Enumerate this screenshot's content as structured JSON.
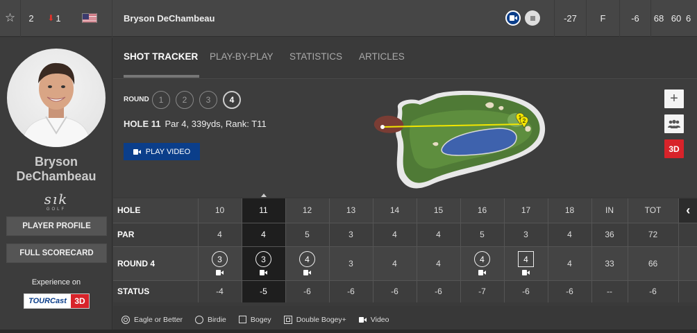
{
  "top_row": {
    "position": "2",
    "movement": "1",
    "player_name": "Bryson DeChambeau",
    "total": "-27",
    "thru": "F",
    "today": "-6",
    "rounds": [
      "68",
      "60",
      "6"
    ]
  },
  "left": {
    "name_line1": "Bryson",
    "name_line2": "DeChambeau",
    "sponsor": "sık",
    "sponsor_sub": "GOLF",
    "profile_btn": "PLAYER PROFILE",
    "scorecard_btn": "FULL SCORECARD",
    "experience": "Experience on",
    "tourcast": "TOURCast",
    "tourcast_3d": "3D"
  },
  "tabs": [
    "SHOT TRACKER",
    "PLAY-BY-PLAY",
    "STATISTICS",
    "ARTICLES"
  ],
  "shot_tracker": {
    "round_label": "ROUND",
    "rounds": [
      "1",
      "2",
      "3",
      "4"
    ],
    "hole": "HOLE 11",
    "hole_detail": "Par 4, 339yds, Rank: T11",
    "play_video": "PLAY VIDEO",
    "zoom_plus": "+",
    "mode_3d": "3D",
    "shot_markers": [
      "1",
      "2"
    ]
  },
  "scorecard": {
    "labels": {
      "hole": "HOLE",
      "par": "PAR",
      "round": "ROUND 4",
      "status": "STATUS"
    },
    "holes": [
      "10",
      "11",
      "12",
      "13",
      "14",
      "15",
      "16",
      "17",
      "18",
      "IN",
      "TOT"
    ],
    "par": [
      "4",
      "4",
      "5",
      "3",
      "4",
      "4",
      "5",
      "3",
      "4",
      "36",
      "72"
    ],
    "round_scores": [
      "3",
      "3",
      "4",
      "3",
      "4",
      "4",
      "4",
      "4",
      "4",
      "33",
      "66"
    ],
    "score_types": [
      "birdie",
      "birdie",
      "birdie",
      "par",
      "par",
      "par",
      "birdie",
      "bogey",
      "par",
      "total",
      "total"
    ],
    "video": [
      true,
      true,
      true,
      false,
      false,
      false,
      true,
      true,
      false,
      false,
      false
    ],
    "status": [
      "-4",
      "-5",
      "-6",
      "-6",
      "-6",
      "-6",
      "-7",
      "-6",
      "-6",
      "--",
      "-6"
    ],
    "collapse_icon": "‹"
  },
  "legend": [
    "Eagle or Better",
    "Birdie",
    "Bogey",
    "Double Bogey+",
    "Video"
  ],
  "colors": {
    "accent_red": "#d8232a",
    "video_blue": "#0b3e8a",
    "current_hole": "#1e1e1e"
  }
}
